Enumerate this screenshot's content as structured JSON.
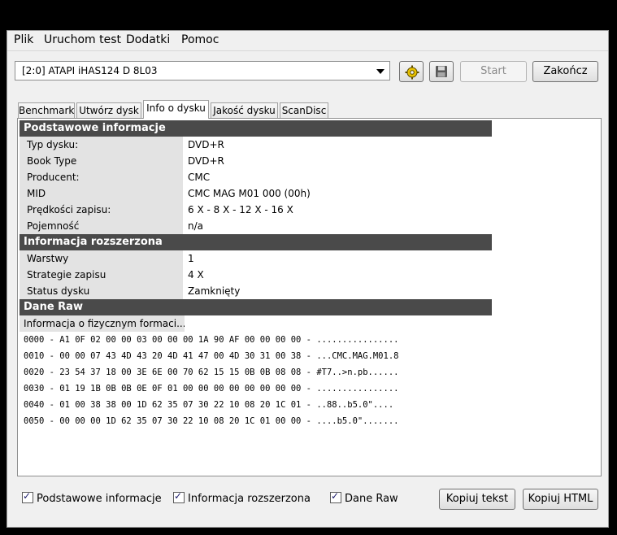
{
  "menu": [
    "Plik",
    "Uruchom test",
    "Dodatki",
    "Pomoc"
  ],
  "toolbar": {
    "drive_selected": "[2:0]    ATAPI iHAS124    D 8L03",
    "start_label": "Start",
    "exit_label": "Zakończ"
  },
  "tabs": [
    {
      "label": "Benchmark",
      "active": false
    },
    {
      "label": "Utwórz dysk",
      "active": false
    },
    {
      "label": "Info o dysku",
      "active": true
    },
    {
      "label": "Jakość dysku",
      "active": false
    },
    {
      "label": "ScanDisc",
      "active": false
    }
  ],
  "sections": {
    "basic": {
      "title": "Podstawowe informacje",
      "rows": [
        {
          "k": "Typ dysku:",
          "v": "DVD+R"
        },
        {
          "k": "Book Type",
          "v": "DVD+R"
        },
        {
          "k": "Producent:",
          "v": "CMC"
        },
        {
          "k": "MID",
          "v": "CMC MAG M01 000 (00h)"
        },
        {
          "k": "Prędkości zapisu:",
          "v": "6 X - 8 X - 12 X - 16 X"
        },
        {
          "k": "Pojemność",
          "v": "n/a"
        }
      ]
    },
    "extended": {
      "title": "Informacja rozszerzona",
      "rows": [
        {
          "k": "Warstwy",
          "v": "1"
        },
        {
          "k": "Strategie zapisu",
          "v": "4 X"
        },
        {
          "k": "Status dysku",
          "v": "Zamknięty"
        }
      ]
    },
    "raw": {
      "title": "Dane Raw",
      "label": "Informacja o fizycznym formaci...",
      "lines": [
        "0000 - A1 0F 02 00 00 03 00 00 00 1A 90 AF 00 00 00 00 - ................",
        "0010 - 00 00 07 43 4D 43 20 4D 41 47 00 4D 30 31 00 38 - ...CMC.MAG.M01.8",
        "0020 - 23 54 37 18 00 3E 6E 00 70 62 15 15 0B 0B 08 08 - #T7..>n.pb......",
        "0030 - 01 19 1B 0B 0B 0E 0F 01 00 00 00 00 00 00 00 00 - ................",
        "0040 - 01 00 38 38 00 1D 62 35 07 30 22 10 08 20 1C 01 - ..88..b5.0\"....",
        "0050 - 00 00 00 1D 62 35 07 30 22 10 08 20 1C 01 00 00 - ....b5.0\"......."
      ]
    }
  },
  "bottom": {
    "checks": [
      "Podstawowe informacje",
      "Informacja rozszerzona",
      "Dane Raw"
    ],
    "copy_text_label": "Kopiuj tekst",
    "copy_html_label": "Kopiuj HTML"
  },
  "icons": {
    "gear": "gear-icon",
    "save": "floppy-icon"
  },
  "colors": {
    "section_header": "#4a4a4a",
    "key_cell": "#e3e3e3",
    "gear_accent": "#e8c200"
  }
}
